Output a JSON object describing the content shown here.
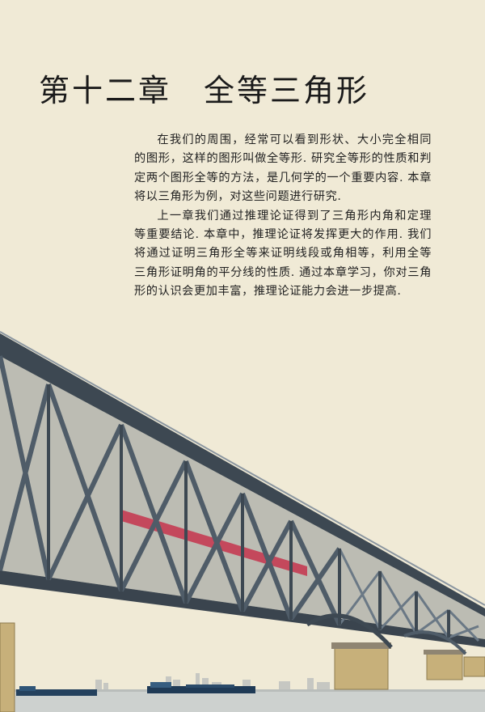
{
  "chapter": {
    "number": "第十二章",
    "title": "全等三角形"
  },
  "intro": {
    "paragraphs": [
      "在我们的周围，经常可以看到形状、大小完全相同的图形，这样的图形叫做全等形. 研究全等形的性质和判定两个图形全等的方法，是几何学的一个重要内容. 本章将以三角形为例，对这些问题进行研究.",
      "上一章我们通过推理论证得到了三角形内角和定理等重要结论. 本章中，推理论证将发挥更大的作用. 我们将通过证明三角形全等来证明线段或角相等，利用全等三角形证明角的平分线的性质. 通过本章学习，你对三角形的认识会更加丰富，推理论证能力会进一步提高."
    ]
  },
  "colors": {
    "background": "#f0ead6",
    "sky": "#f1ebd8",
    "steel": "#4a5866",
    "steel_dark": "#2b333c",
    "train": "#c0475a",
    "water": "#cfd3d0",
    "pier": "#c9b27a"
  }
}
